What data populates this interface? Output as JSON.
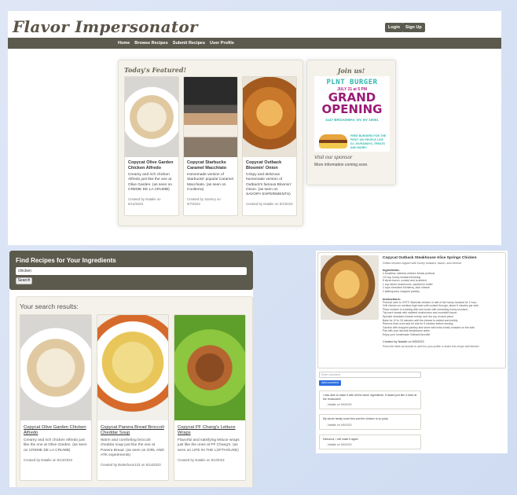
{
  "home": {
    "logo": "Flavor Impersonator",
    "login_label": "Login",
    "signup_label": "Sign Up",
    "nav": [
      "Home",
      "Browse Recipes",
      "Submit Recipes",
      "User Profile"
    ],
    "featured_title": "Today's Featured!",
    "featured": [
      {
        "title": "Copycat Olive Garden Chicken Alfredo",
        "desc": "Creamy and rich chicken Alfredo just like the one at Olive Garden. (as seen on CREME DE LA CRUMB)",
        "credit": "Created by Natalie on 5/14/2023"
      },
      {
        "title": "Copycat Starbucks Caramel Macchiato",
        "desc": "Homemade version of Starbucks' popular Caramel Macchiato. (as seen on Coolterra)",
        "credit": "Created by Sammy on 5/7/2023"
      },
      {
        "title": "Copycat Outback Bloomin' Onion",
        "desc": "Crispy and delicious homemade version of Outback's famous Bloomin' Onion. (as seen on SAVORY EXPERIMENTS)",
        "credit": "Created by Natalie on 5/1/2023"
      }
    ],
    "join_title": "Join us!",
    "ad": {
      "brand": "PLNT BURGER",
      "date": "JULY 21 at 5 PM",
      "grand": "GRAND",
      "opening": "OPENING",
      "address": "1147 BROADWAY, NY, NY 10001",
      "promo": "FREE BURGERS FOR THE FIRST 100 PEOPLE LIVE DJ, GIVEAWAYS, TREATS AND MORE!"
    },
    "visit_sponsor": "Visit our sponsor",
    "more_info": "More information coming soon."
  },
  "search": {
    "heading": "Find Recipes for Your Ingredients",
    "input_value": "chicken",
    "search_label": "Search",
    "results_heading": "Your search results:",
    "results": [
      {
        "title": "Copycat Olive Garden Chicken Alfredo",
        "desc": "Creamy and rich chicken Alfredo just like the one at Olive Garden. (as seen on CREME DE LA CRUMB)",
        "credit": "Created by Natalie on 5/14/2023"
      },
      {
        "title": "Copycat Panera Bread Broccoli Cheddar Soup",
        "desc": "Warm and comforting broccoli cheddar soup just like the one at Panera Bread. (as seen on GIRL AND ATK experiments)",
        "credit": "Created by Butterbunn123 on 5/14/2023"
      },
      {
        "title": "Copycat PF Chang's Lettuce Wraps",
        "desc": "Flavorful and satisfying lettuce wraps just like the ones at PF Chang's. (as seen on LIFE IN THE LOFTHOUSE)",
        "credit": "Created by Natalie on 5/1/2023"
      }
    ]
  },
  "detail": {
    "title": "Copycat Outback Steakhouse Alice Springs Chicken",
    "subtitle": "Grilled chicken topped with honey mustard, bacon, and cheese.",
    "ingredients_heading": "Ingredients:",
    "ingredients": [
      "4 boneless, skinless chicken breast portions",
      "1/2 cup honey mustard dressing",
      "8 slices bacon, cooked and crumbled",
      "1 cup sliced mushrooms, sauteed in butter",
      "2 cups shredded Monterey Jack cheese",
      "2 tablespoons chopped parsley"
    ],
    "instructions_heading": "Instructions:",
    "instructions": [
      "Preheat oven to 375°F. Marinate chicken in half of the honey mustard for 1 hour.",
      "Grill chicken on medium-high heat until cooked through, about 5 minutes per side.",
      "Place chicken in a baking dish and brush with remaining honey mustard.",
      "Top each breast with sauteed mushrooms and crumbled bacon.",
      "Sprinkle shredded cheese evenly over the top of each piece.",
      "Bake for 10 to 15 minutes until the cheese is melted and bubbly.",
      "Remove from oven and let rest for 5 minutes before serving.",
      "Garnish with chopped parsley and serve with extra honey mustard on the side.",
      "Pair with your favorite steakhouse sides.",
      "Enjoy your homemade Outback favorite!"
    ],
    "created_by": "Created by Natalie on 5/5/2023",
    "note": "Press the Mark as favorite to add it to your profile or share this recipe with friends!",
    "comment_placeholder": "Enter comment",
    "add_comment_label": "Add comment",
    "comments": [
      {
        "text": "I was able to make it with all the same ingredients. It tasted just like it does at the restaurant!",
        "by": "- Natalie on 5/5/2023"
      },
      {
        "text": "My whole family loved this and the chicken is so juicy!",
        "by": "- Natalie on 5/5/2023"
      },
      {
        "text": "Delicious, I will make it again",
        "by": "- Natalie on 5/5/2023"
      }
    ]
  }
}
